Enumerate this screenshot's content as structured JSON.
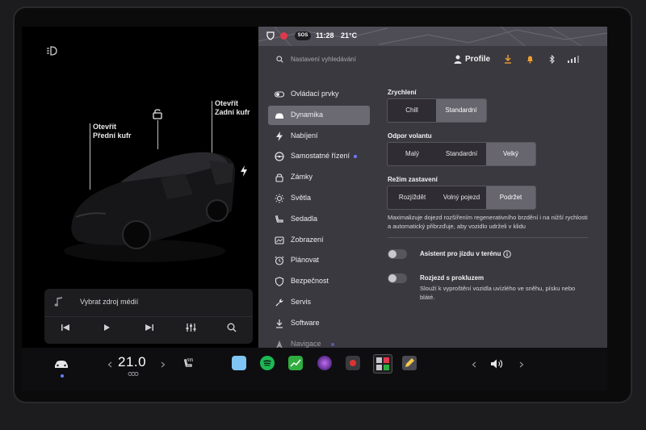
{
  "status_bar": {
    "sos_label": "SOS",
    "time": "11:28",
    "outside_temp": "21°C"
  },
  "search": {
    "placeholder": "Nastavení vyhledávání",
    "profile_label": "Profile"
  },
  "car_panel": {
    "front_trunk_label": "Otevřít\nPřední kufr",
    "rear_trunk_label": "Otevřít\nZadní kufr",
    "media_source_label": "Vybrat zdroj médií"
  },
  "nav": {
    "items": [
      {
        "label": "Ovládací prvky",
        "icon": "toggle-icon"
      },
      {
        "label": "Dynamika",
        "icon": "car-icon",
        "active": true
      },
      {
        "label": "Nabíjení",
        "icon": "bolt-icon"
      },
      {
        "label": "Samostatné řízení",
        "icon": "steering-wheel-icon",
        "dot": true
      },
      {
        "label": "Zámky",
        "icon": "lock-icon"
      },
      {
        "label": "Světla",
        "icon": "sun-icon"
      },
      {
        "label": "Sedadla",
        "icon": "seat-icon"
      },
      {
        "label": "Zobrazení",
        "icon": "display-icon"
      },
      {
        "label": "Plánovat",
        "icon": "alarm-clock-icon"
      },
      {
        "label": "Bezpečnost",
        "icon": "shield-icon"
      },
      {
        "label": "Servis",
        "icon": "wrench-icon"
      },
      {
        "label": "Software",
        "icon": "download-icon"
      },
      {
        "label": "Navigace",
        "icon": "navigation-icon",
        "dot": true
      }
    ]
  },
  "dynamics": {
    "acceleration": {
      "title": "Zrychlení",
      "options": [
        "Chill",
        "Standardní"
      ],
      "selected": "Standardní"
    },
    "steering": {
      "title": "Odpor volantu",
      "options": [
        "Malý",
        "Standardní",
        "Velký"
      ],
      "selected": "Velký"
    },
    "stopping": {
      "title": "Režim zastavení",
      "options": [
        "Rozjíždět",
        "Volný pojezd",
        "Podržet"
      ],
      "selected": "Podržet",
      "description": "Maximalizuje dojezd rozšířením regenerativního brzdění i na nižší rychlosti a automatický přibrzďuje, aby vozidlo udrželi v klidu"
    },
    "offroad": {
      "label": "Asistent pro jízdu v terénu",
      "on": false
    },
    "slip_start": {
      "label": "Rozjezd s prokluzem",
      "on": false,
      "description": "Slouží k vyproštění vozidla uvízlého ve sněhu, písku nebo bláté."
    }
  },
  "dock": {
    "temperature": "21.0"
  },
  "colors": {
    "panel_bg": "#3b3940",
    "selected_segment": "#67656d",
    "active_nav": "#6b6972",
    "accent_dot": "#6c7bff",
    "status_red": "#e0384b"
  }
}
